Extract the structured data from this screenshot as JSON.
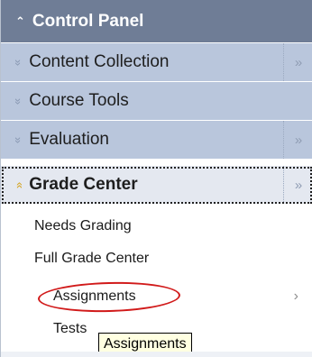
{
  "control_panel": {
    "title": "Control Panel",
    "chevron_icon": "chevron-up-double-icon"
  },
  "menu": {
    "items": [
      {
        "label": "Content Collection",
        "expand_icon": "chevron-down-double-icon",
        "has_flyout": true,
        "flyout_icon": "chevron-right-double-icon"
      },
      {
        "label": "Course Tools",
        "expand_icon": "chevron-down-double-icon",
        "has_flyout": false
      },
      {
        "label": "Evaluation",
        "expand_icon": "chevron-down-double-icon",
        "has_flyout": true,
        "flyout_icon": "chevron-right-double-icon"
      },
      {
        "label": "Grade Center",
        "expand_icon": "chevron-up-double-icon",
        "has_flyout": true,
        "flyout_icon": "chevron-right-double-icon",
        "active": true
      }
    ]
  },
  "grade_center_submenu": {
    "items": [
      {
        "label": "Needs Grading"
      },
      {
        "label": "Full Grade Center"
      },
      {
        "label": "Assignments",
        "selected": true,
        "arrow": "›"
      },
      {
        "label": "Tests"
      }
    ]
  },
  "tooltip": {
    "text": "Assignments"
  },
  "colors": {
    "header_bg": "#6f7d96",
    "row_bg": "#b9c6dc",
    "active_row_bg": "#e4e8f0",
    "highlight_circle": "#d11a1a",
    "active_chevron": "#d4a21a",
    "tooltip_bg": "#ffffe1"
  }
}
